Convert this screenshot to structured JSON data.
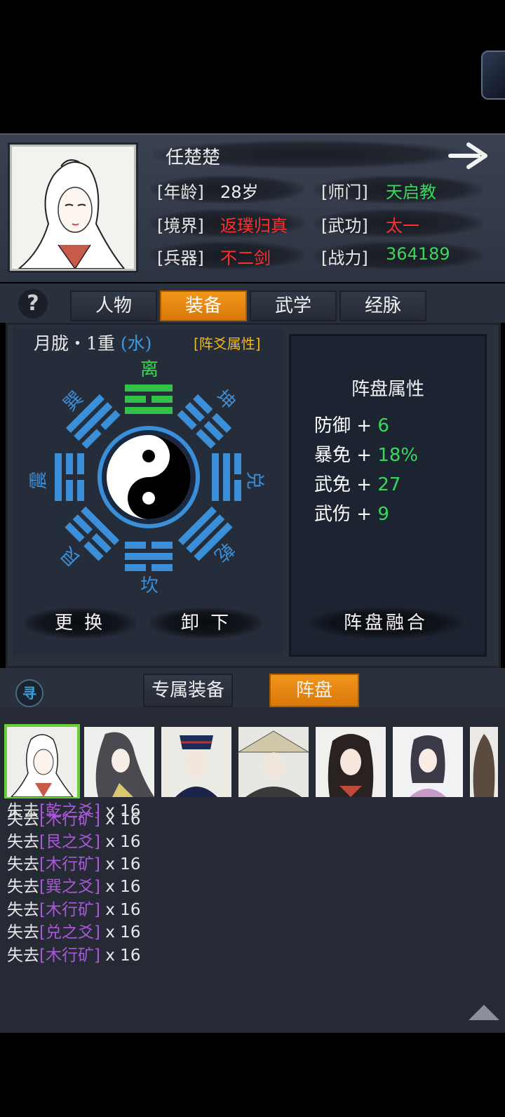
{
  "character": {
    "name": "任楚楚",
    "age_label": "[年龄]",
    "age": "28岁",
    "sect_label": "[师门]",
    "sect": "天启教",
    "realm_label": "[境界]",
    "realm": "返璞归真",
    "martial_label": "[武功]",
    "martial": "太一",
    "weapon_label": "[兵器]",
    "weapon": "不二剑",
    "power_label": "[战力]",
    "power": "364189"
  },
  "tabs": [
    {
      "label": "人物",
      "active": false
    },
    {
      "label": "装备",
      "active": true
    },
    {
      "label": "武学",
      "active": false
    },
    {
      "label": "经脉",
      "active": false
    }
  ],
  "formation": {
    "name": "月胧・1重",
    "element": "(水)",
    "yao_link": "[阵爻属性]",
    "trigrams": {
      "li": "离",
      "kun": "坤",
      "dui": "兑",
      "qian": "乾",
      "kan": "坎",
      "gen": "艮",
      "zhen": "震",
      "xun": "巽"
    },
    "btn_change": "更 换",
    "btn_unload": "卸 下",
    "btn_merge": "阵盘融合"
  },
  "attributes": {
    "title": "阵盘属性",
    "items": [
      {
        "name": "防御",
        "plus": "+",
        "value": "6"
      },
      {
        "name": "暴免",
        "plus": "+",
        "value": "18%"
      },
      {
        "name": "武免",
        "plus": "+",
        "value": "27"
      },
      {
        "name": "武伤",
        "plus": "+",
        "value": "9"
      }
    ]
  },
  "bottom_tabs": [
    {
      "label": "专属装备",
      "active": false
    },
    {
      "label": "阵盘",
      "active": true
    }
  ],
  "seek_icon_text": "寻",
  "log": [
    {
      "prefix": "失去",
      "item": "[乾之爻]",
      "count": " x 16"
    },
    {
      "prefix": "失去",
      "item": "[木行矿]",
      "count": " x 16"
    },
    {
      "prefix": "失去",
      "item": "[艮之爻]",
      "count": " x 16"
    },
    {
      "prefix": "失去",
      "item": "[木行矿]",
      "count": " x 16"
    },
    {
      "prefix": "失去",
      "item": "[巽之爻]",
      "count": " x 16"
    },
    {
      "prefix": "失去",
      "item": "[木行矿]",
      "count": " x 16"
    },
    {
      "prefix": "失去",
      "item": "[兑之爻]",
      "count": " x 16"
    },
    {
      "prefix": "失去",
      "item": "[木行矿]",
      "count": " x 16"
    }
  ],
  "colors": {
    "accent_orange": "#f2961a",
    "trigram_blue": "#3a8fd8",
    "trigram_green": "#2fc247",
    "value_green": "#38d85a",
    "value_red": "#ff2f2f",
    "log_purple": "#a858d8"
  }
}
